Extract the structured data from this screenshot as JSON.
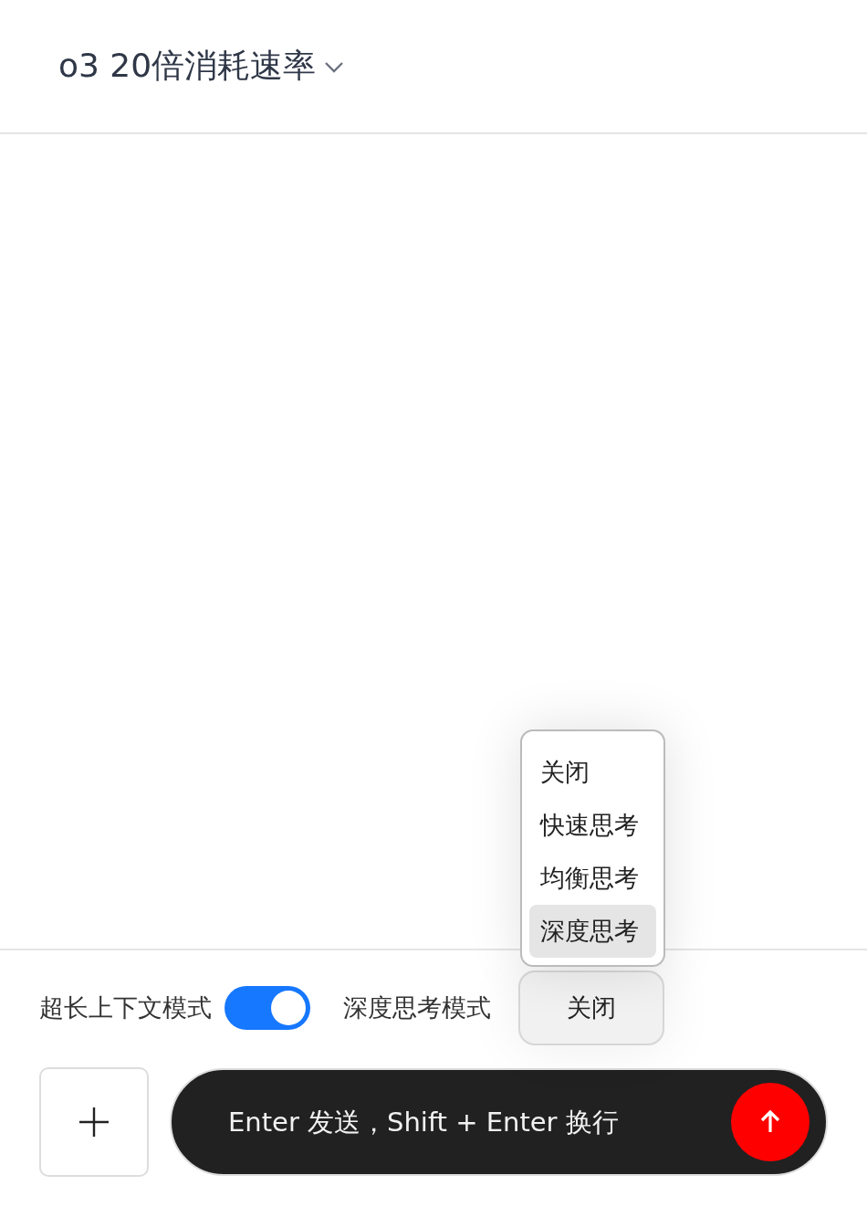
{
  "header": {
    "model_name": "o3 20倍消耗速率"
  },
  "controls": {
    "long_context": {
      "label": "超长上下文模式",
      "on": true
    },
    "deep_thinking": {
      "label": "深度思考模式",
      "value": "关闭"
    }
  },
  "thinking_menu": {
    "open": true,
    "options": [
      {
        "label": "关闭",
        "selected": false
      },
      {
        "label": "快速思考",
        "selected": false
      },
      {
        "label": "均衡思考",
        "selected": false
      },
      {
        "label": "深度思考",
        "selected": true
      }
    ]
  },
  "composer": {
    "placeholder": "Enter 发送，Shift + Enter 换行"
  }
}
